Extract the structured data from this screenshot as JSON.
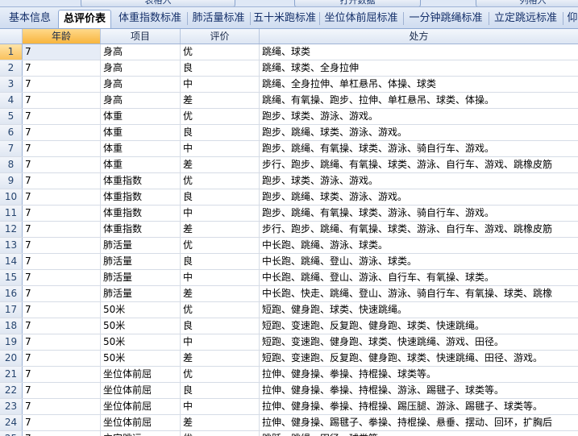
{
  "top_buttons": [
    "表格入",
    "打开数据",
    "列格入"
  ],
  "tabs": [
    {
      "label": "基本信息",
      "active": false
    },
    {
      "label": "总评价表",
      "active": true
    },
    {
      "label": "体重指数标准",
      "active": false
    },
    {
      "label": "肺活量标准",
      "active": false
    },
    {
      "label": "五十米跑标准",
      "active": false
    },
    {
      "label": "坐位体前屈标准",
      "active": false
    },
    {
      "label": "一分钟跳绳标准",
      "active": false
    },
    {
      "label": "立定跳远标准",
      "active": false
    },
    {
      "label": "仰",
      "active": false
    }
  ],
  "columns": [
    "年龄",
    "项目",
    "评价",
    "处方"
  ],
  "rows": [
    {
      "n": "1",
      "age": "7",
      "item": "身高",
      "eval": "优",
      "rx": "跳绳、球类"
    },
    {
      "n": "2",
      "age": "7",
      "item": "身高",
      "eval": "良",
      "rx": "跳绳、球类、全身拉伸"
    },
    {
      "n": "3",
      "age": "7",
      "item": "身高",
      "eval": "中",
      "rx": "跳绳、全身拉伸、单杠悬吊、体操、球类"
    },
    {
      "n": "4",
      "age": "7",
      "item": "身高",
      "eval": "差",
      "rx": "跳绳、有氧操、跑步、拉伸、单杠悬吊、球类、体操。"
    },
    {
      "n": "5",
      "age": "7",
      "item": "体重",
      "eval": "优",
      "rx": "跑步、球类、游泳、游戏。"
    },
    {
      "n": "6",
      "age": "7",
      "item": "体重",
      "eval": "良",
      "rx": "跑步、跳绳、球类、游泳、游戏。"
    },
    {
      "n": "7",
      "age": "7",
      "item": "体重",
      "eval": "中",
      "rx": "跑步、跳绳、有氧操、球类、游泳、骑自行车、游戏。"
    },
    {
      "n": "8",
      "age": "7",
      "item": "体重",
      "eval": "差",
      "rx": "步行、跑步、跳绳、有氧操、球类、游泳、自行车、游戏、跳橡皮筋"
    },
    {
      "n": "9",
      "age": "7",
      "item": "体重指数",
      "eval": "优",
      "rx": "跑步、球类、游泳、游戏。"
    },
    {
      "n": "10",
      "age": "7",
      "item": "体重指数",
      "eval": "良",
      "rx": "跑步、跳绳、球类、游泳、游戏。"
    },
    {
      "n": "11",
      "age": "7",
      "item": "体重指数",
      "eval": "中",
      "rx": "跑步、跳绳、有氧操、球类、游泳、骑自行车、游戏。"
    },
    {
      "n": "12",
      "age": "7",
      "item": "体重指数",
      "eval": "差",
      "rx": "步行、跑步、跳绳、有氧操、球类、游泳、自行车、游戏、跳橡皮筋"
    },
    {
      "n": "13",
      "age": "7",
      "item": "肺活量",
      "eval": "优",
      "rx": "中长跑、跳绳、游泳、球类。"
    },
    {
      "n": "14",
      "age": "7",
      "item": "肺活量",
      "eval": "良",
      "rx": "中长跑、跳绳、登山、游泳、球类。"
    },
    {
      "n": "15",
      "age": "7",
      "item": "肺活量",
      "eval": "中",
      "rx": "中长跑、跳绳、登山、游泳、自行车、有氧操、球类。"
    },
    {
      "n": "16",
      "age": "7",
      "item": "肺活量",
      "eval": "差",
      "rx": "中长跑、快走、跳绳、登山、游泳、骑自行车、有氧操、球类、跳橡"
    },
    {
      "n": "17",
      "age": "7",
      "item": "50米",
      "eval": "优",
      "rx": "短跑、健身跑、球类、快速跳绳。"
    },
    {
      "n": "18",
      "age": "7",
      "item": "50米",
      "eval": "良",
      "rx": "短跑、变速跑、反复跑、健身跑、球类、快速跳绳。"
    },
    {
      "n": "19",
      "age": "7",
      "item": "50米",
      "eval": "中",
      "rx": "短跑、变速跑、健身跑、球类、快速跳绳、游戏、田径。"
    },
    {
      "n": "20",
      "age": "7",
      "item": "50米",
      "eval": "差",
      "rx": "短跑、变速跑、反复跑、健身跑、球类、快速跳绳、田径、游戏。"
    },
    {
      "n": "21",
      "age": "7",
      "item": "坐位体前屈",
      "eval": "优",
      "rx": "拉伸、健身操、拳操、持棍操、球类等。"
    },
    {
      "n": "22",
      "age": "7",
      "item": "坐位体前屈",
      "eval": "良",
      "rx": "拉伸、健身操、拳操、持棍操、游泳、踢毽子、球类等。"
    },
    {
      "n": "23",
      "age": "7",
      "item": "坐位体前屈",
      "eval": "中",
      "rx": "拉伸、健身操、拳操、持棍操、踢压腿、游泳、踢毽子、球类等。"
    },
    {
      "n": "24",
      "age": "7",
      "item": "坐位体前屈",
      "eval": "差",
      "rx": "拉伸、健身操、踢毽子、拳操、持棍操、悬垂、摆动、回环，扩胸后"
    },
    {
      "n": "25",
      "age": "7",
      "item": "立定跳远",
      "eval": "优",
      "rx": "跳跃、跳绳、田径、球类等。"
    }
  ]
}
